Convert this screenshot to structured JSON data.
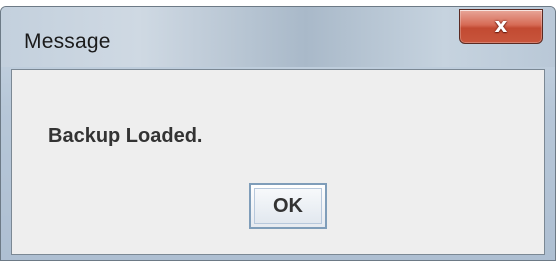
{
  "window": {
    "title": "Message",
    "close_glyph": "x",
    "close_icon": "close-icon"
  },
  "message": {
    "text": "Backup Loaded."
  },
  "buttons": {
    "ok_label": "OK"
  },
  "colors": {
    "titlebar": "#b7c7d8",
    "close_button": "#c8553c",
    "client_background": "#eeeeee",
    "ok_border": "#7f9db9"
  }
}
